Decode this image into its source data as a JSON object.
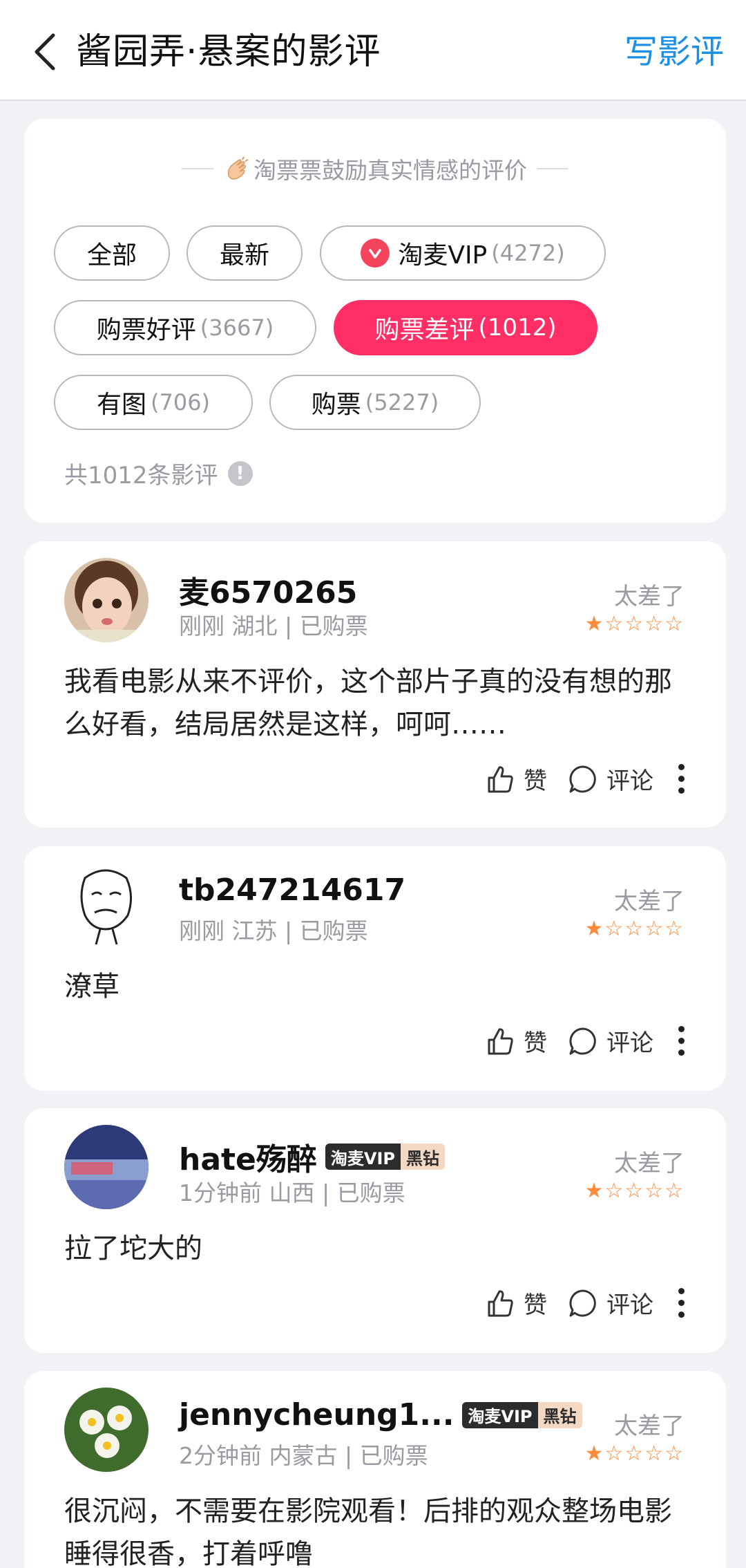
{
  "header": {
    "title": "酱园弄·悬案的影评",
    "write_label": "写影评"
  },
  "filter": {
    "encourage_text": "淘票票鼓励真实情感的评价",
    "chips": [
      {
        "label": "全部",
        "count": ""
      },
      {
        "label": "最新",
        "count": ""
      },
      {
        "label": "淘麦VIP",
        "count": "(4272)"
      },
      {
        "label": "购票好评",
        "count": "(3667)"
      },
      {
        "label": "购票差评",
        "count": "(1012)"
      },
      {
        "label": "有图",
        "count": "(706)"
      },
      {
        "label": "购票",
        "count": "(5227)"
      }
    ],
    "total_text": "共1012条影评"
  },
  "reviews": [
    {
      "username": "麦6570265",
      "meta": "刚刚 湖北 | 已购票",
      "rating_text": "太差了",
      "stars": 1,
      "text": "我看电影从来不评价，这个部片子真的没有想的那么好看，结局居然是这样，呵呵……",
      "vip": false
    },
    {
      "username": "tb247214617",
      "meta": "刚刚 江苏 | 已购票",
      "rating_text": "太差了",
      "stars": 1,
      "text": "潦草",
      "vip": false
    },
    {
      "username": "hate殇醉",
      "meta": "1分钟前 山西 | 已购票",
      "rating_text": "太差了",
      "stars": 1,
      "text": "拉了坨大的",
      "vip": true
    },
    {
      "username": "jennycheung1...",
      "meta": "2分钟前 内蒙古 | 已购票",
      "rating_text": "太差了",
      "stars": 1,
      "text": "很沉闷，不需要在影院观看！后排的观众整场电影睡得很香，打着呼噜",
      "vip": true
    }
  ],
  "vip_badge": {
    "left": "淘麦VIP",
    "right": "黑钻"
  },
  "actions": {
    "like_label": "赞",
    "comment_label": "评论"
  },
  "colors": {
    "accent_blue": "#1a8fe3",
    "active_chip": "#ff2f66",
    "star": "#ff8a3c"
  }
}
